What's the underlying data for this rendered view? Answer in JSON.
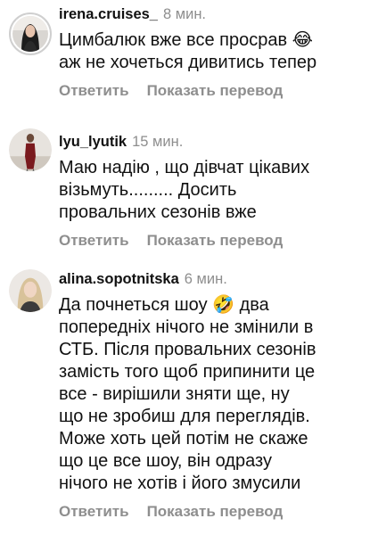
{
  "comments": [
    {
      "username": "irena.cruises_",
      "time": "8 мин.",
      "lines": [
        "Цимбалюк вже все просрав 😂",
        "аж не хочеться дивитись тепер"
      ],
      "avatar_icon": "profile-photo-dark-hair-woman",
      "reply_label": "Ответить",
      "translate_label": "Показать перевод"
    },
    {
      "username": "lyu_lyutik",
      "time": "15 мин.",
      "lines": [
        "Маю надію , що дівчат цікавих",
        "візьмуть......... Досить",
        "провальних сезонів вже"
      ],
      "avatar_icon": "profile-photo-woman-red-dress",
      "reply_label": "Ответить",
      "translate_label": "Показать перевод"
    },
    {
      "username": "alina.sopotnitska",
      "time": "6 мин.",
      "lines": [
        "Да почнеться шоу 🤣 два",
        "попередніх нічого не змінили в",
        "СТБ. Після провальних сезонів",
        "замість того щоб припинити це",
        "все -  вирішили зняти ще, ну",
        "що не зробиш для переглядів.",
        "Може хоть цей потім не скаже",
        "що це все шоу, він одразу",
        "нічого не хотів і його змусили"
      ],
      "avatar_icon": "profile-photo-blonde-woman",
      "reply_label": "Ответить",
      "translate_label": "Показать перевод"
    }
  ],
  "colors": {
    "text": "#111111",
    "secondary": "#8e8e8e",
    "background": "#ffffff"
  }
}
